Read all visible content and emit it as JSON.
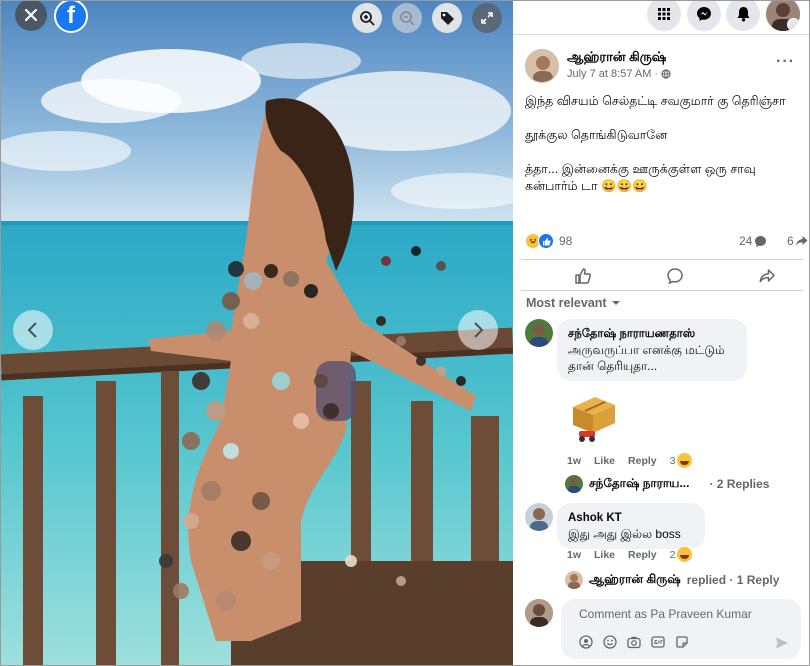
{
  "post": {
    "author": "ஆஹ்ரான் கிருஷ்",
    "time": "July 7 at 8:57 AM",
    "more_label": "···",
    "text_lines": [
      "இந்த விசயம் செல்தட்டி சவகுமார் கு தெரிஞ்சா",
      "தூக்குல தொங்கிடுவானே",
      "த்தா... இன்னைக்கு ஊருக்குள்ள ஒரு சாவு கன்பார்ம் டா 😀😀😀"
    ],
    "reactions_count": "98",
    "comments_count": "24",
    "shares_count": "6"
  },
  "sort_label": "Most relevant",
  "comments": [
    {
      "name": "சந்தோஷ் நாராயணதாஸ்",
      "text": "அருவருப்பா எனக்கு மட்டும் தான் தெரியுதா...",
      "time": "1w",
      "like": "Like",
      "reply": "Reply",
      "react_count": "3"
    },
    {
      "name": "Ashok KT",
      "text": "இது அது இல்ல boss",
      "time": "1w",
      "like": "Like",
      "reply": "Reply",
      "react_count": "2"
    }
  ],
  "reply_summaries": [
    {
      "name": "சந்தோஷ் நாராய...",
      "extra": "· 2 Replies"
    },
    {
      "name": "ஆஹ்ரான் கிருஷ்",
      "extra": "replied · 1 Reply"
    }
  ],
  "comment_input": {
    "placeholder": "Comment as Pa Praveen Kumar"
  },
  "colors": {
    "brand": "#1877f2",
    "muted": "#65676b",
    "bubble": "#f0f2f5"
  }
}
